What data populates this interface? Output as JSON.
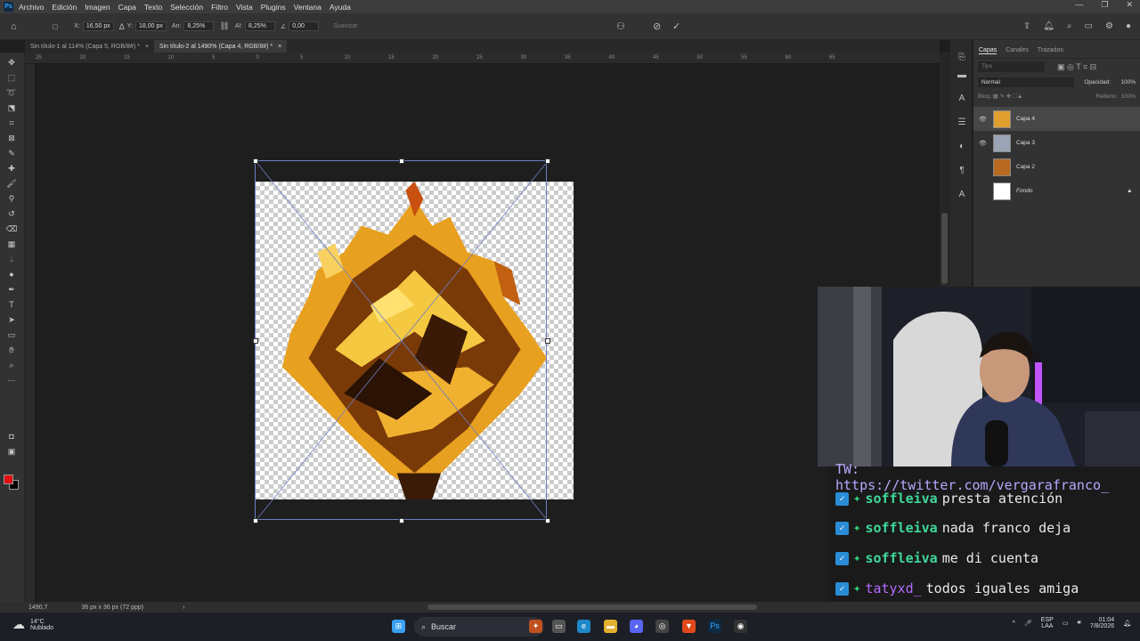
{
  "app": {
    "logo": "Ps",
    "menu": [
      "Archivo",
      "Edición",
      "Imagen",
      "Capa",
      "Texto",
      "Selección",
      "Filtro",
      "Vista",
      "Plugins",
      "Ventana",
      "Ayuda"
    ]
  },
  "options": {
    "x_label": "X:",
    "x_value": "16,50 px",
    "y_label": "Y:",
    "y_value": "18,00 px",
    "w_label": "An:",
    "w_value": "8,25%",
    "h_label": "Al:",
    "h_value": "8,25%",
    "angle_value": "0,00",
    "smooth_label": "Suavizar"
  },
  "tabs": [
    {
      "label": "Sin título-1 al 114% (Capa 5, RGB/8#) *"
    },
    {
      "label": "Sin título-2 al 1490% (Capa 4, RGB/8#) *"
    }
  ],
  "rulers": {
    "top": [
      "25",
      "20",
      "15",
      "10",
      "5",
      "0",
      "5",
      "10",
      "15",
      "20",
      "25",
      "30",
      "35",
      "40",
      "45",
      "50",
      "55",
      "60",
      "65"
    ]
  },
  "status": {
    "zoom": "1490,7",
    "doc_size": "36 px x 36 px (72 ppp)"
  },
  "layers_panel": {
    "tabs": [
      "Capas",
      "Canales",
      "Trazados"
    ],
    "filter_placeholder": "Tipo",
    "blend_mode": "Normal",
    "opacity_label": "Opacidad:",
    "opacity_value": "100%",
    "lock_label": "Bloq.:",
    "fill_label": "Relleno:",
    "fill_value": "100%",
    "layers": [
      {
        "name": "Capa 4",
        "visible": true
      },
      {
        "name": "Capa 3",
        "visible": true
      },
      {
        "name": "Capa 2",
        "visible": false
      },
      {
        "name": "Fondo",
        "visible": false
      }
    ]
  },
  "chat": {
    "partial_line": "TW: https://twitter.com/vergarafranco_",
    "messages": [
      {
        "user": "soffleiva",
        "text": "presta atención"
      },
      {
        "user": "soffleiva",
        "text": "nada franco deja"
      },
      {
        "user": "soffleiva",
        "text": "me di cuenta"
      },
      {
        "user": "tatyxd_",
        "text": "todos iguales amiga"
      }
    ]
  },
  "taskbar": {
    "temp": "14°C",
    "weather": "Nublado",
    "search": "Buscar",
    "lang_1": "ESP",
    "lang_2": "LAA",
    "time": "01:04",
    "date": "7/8/2026"
  }
}
